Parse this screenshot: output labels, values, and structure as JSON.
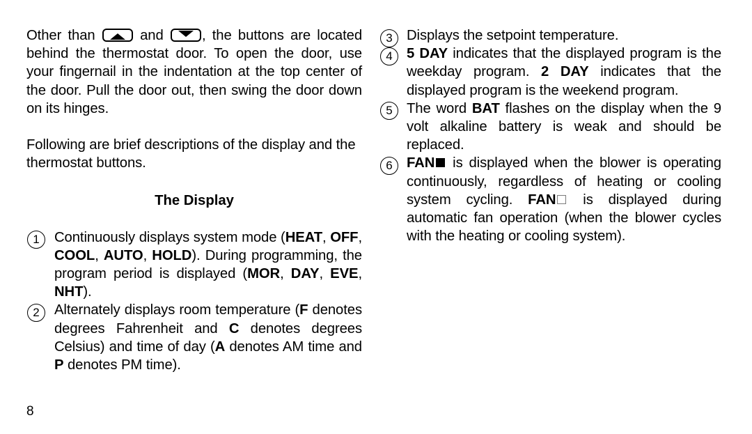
{
  "page": {
    "number": "8"
  },
  "left_column": {
    "intro_paragraph": {
      "before_up_button": "Other than ",
      "between_buttons": " and ",
      "after_down_button": ", the buttons are located behind the thermostat door. To open the door, use your fingernail in the indentation at the top center of the door.  Pull the door out, then swing the door down on its hinges.",
      "up_button_icon": "triangle-up-key-icon",
      "down_button_icon": "triangle-down-key-icon"
    },
    "second_paragraph": "Following are brief descriptions of the display and the thermostat buttons.",
    "heading": "The Display",
    "items": [
      {
        "number": "1",
        "seg_1": "Continuously displays system mode (",
        "bold_1": "HEAT",
        "seg_2": ", ",
        "bold_2": "OFF",
        "seg_3": ", ",
        "bold_3": "COOL",
        "seg_4": ", ",
        "bold_4": "AUTO",
        "seg_5": ", ",
        "bold_5": "HOLD",
        "seg_6": ").  During programming, the program period is displayed (",
        "bold_6": "MOR",
        "seg_7": ", ",
        "bold_7": "DAY",
        "seg_8": ", ",
        "bold_8": "EVE",
        "seg_9": ", ",
        "bold_9": "NHT",
        "seg_10": ")."
      },
      {
        "number": "2",
        "seg_1": "Alternately displays room temperature (",
        "bold_1": "F",
        "seg_2": " denotes degrees Fahrenheit and ",
        "bold_2": "C",
        "seg_3": " denotes degrees Celsius) and time of day (",
        "bold_3": "A",
        "seg_4": " denotes AM time and ",
        "bold_4": "P",
        "seg_5": " denotes PM time)."
      }
    ]
  },
  "right_column": {
    "items": [
      {
        "number": "3",
        "text": "Displays the setpoint temperature."
      },
      {
        "number": "4",
        "bold_1": "5 DAY",
        "seg_1": " indicates that the displayed program is the weekday program.  ",
        "bold_2": "2 DAY",
        "seg_2": " indicates that the displayed program is the weekend program."
      },
      {
        "number": "5",
        "seg_1": "The word ",
        "bold_1": "BAT",
        "seg_2": " flashes on the display when the 9 volt alkaline battery is weak and should be replaced."
      },
      {
        "number": "6",
        "bold_1": "FAN",
        "filled_square_icon": "fan-filled-square-icon",
        "seg_1": " is displayed when the blower is operating continuously, regardless of heating or cooling system cycling.  ",
        "bold_2": "FAN",
        "open_square_icon": "fan-open-square-icon",
        "seg_2": " is displayed during automatic fan operation (when the blower cycles with the heating or cooling system)."
      }
    ]
  }
}
